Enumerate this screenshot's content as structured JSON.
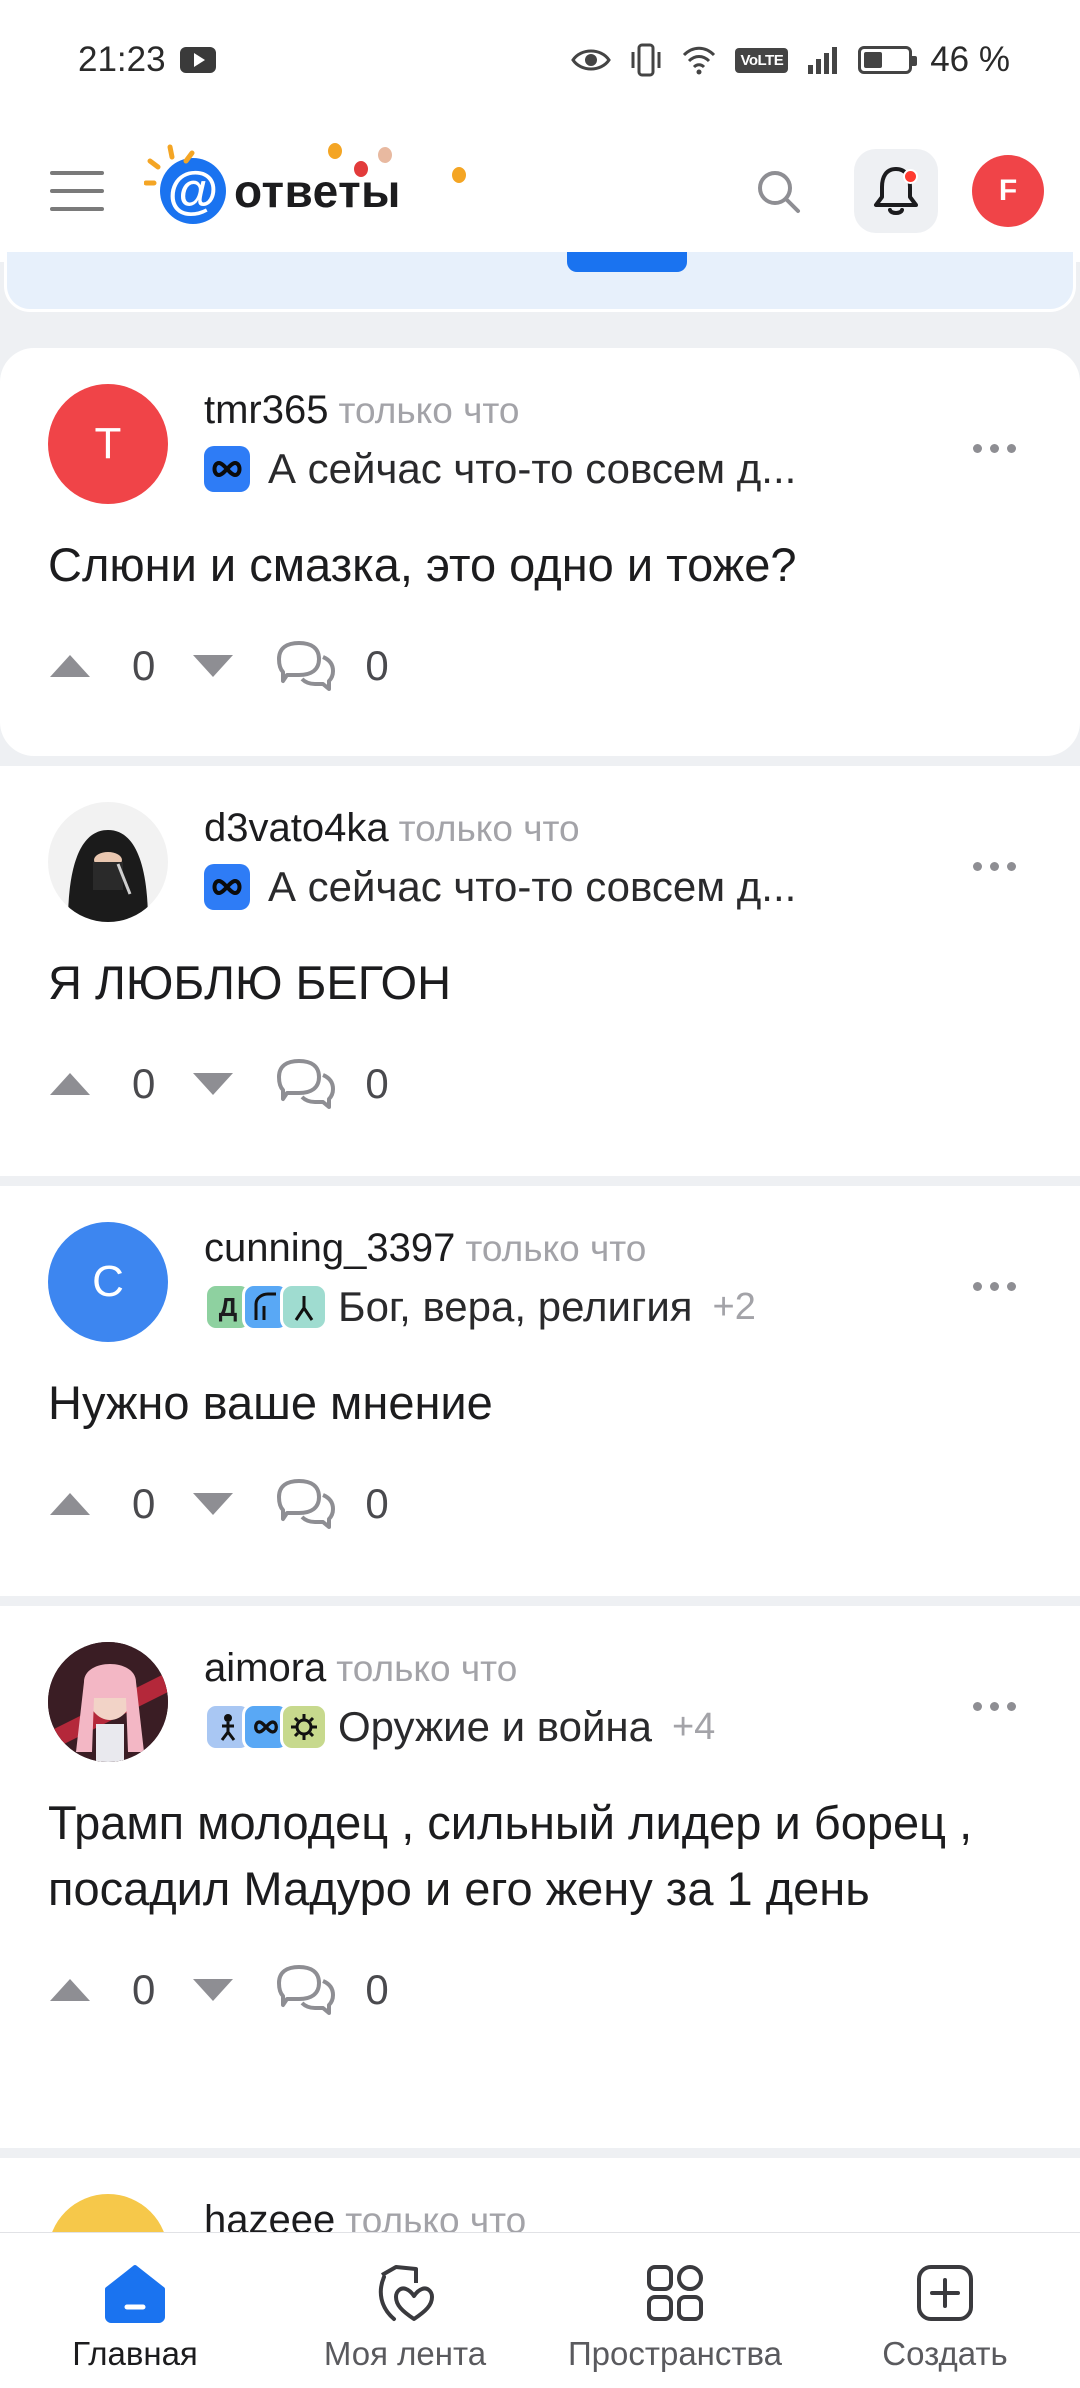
{
  "status_bar": {
    "time": "21:23",
    "volte": "VoLTE",
    "battery": "46 %"
  },
  "header": {
    "logo_text": "ответы"
  },
  "posts": [
    {
      "avatar_letter": "T",
      "avatar_color": "#f04448",
      "author": "tmr365",
      "time": "только что",
      "category": "А сейчас что-то совсем д...",
      "category_more": "",
      "title": "Слюни и смазка, это одно и тоже?",
      "votes": "0",
      "comments": "0"
    },
    {
      "avatar_letter": "",
      "avatar_color": "#ffffff",
      "author": "d3vato4ka",
      "time": "только что",
      "category": "А сейчас что-то совсем д...",
      "category_more": "",
      "title": "Я ЛЮБЛЮ БЕГОН",
      "votes": "0",
      "comments": "0"
    },
    {
      "avatar_letter": "C",
      "avatar_color": "#3d86f0",
      "author": "cunning_3397",
      "time": "только что",
      "category": "Бог, вера, религия",
      "category_more": "+2",
      "title": "Нужно ваше мнение",
      "votes": "0",
      "comments": "0"
    },
    {
      "avatar_letter": "",
      "avatar_color": "#3a1d24",
      "author": "aimora",
      "time": "только что",
      "category": "Оружие и война",
      "category_more": "+4",
      "title": "Трамп молодец , сильный лидер и борец , посадил Мадуро и его жену за 1 день",
      "votes": "0",
      "comments": "0"
    },
    {
      "avatar_letter": "",
      "avatar_color": "#f6c84a",
      "author": "hazeee",
      "time": "только что"
    }
  ],
  "category_icon_letter": "Д",
  "nav": {
    "home": "Главная",
    "feed": "Моя лента",
    "spaces": "Пространства",
    "create": "Создать"
  },
  "colors": {
    "accent": "#1a73f0",
    "text_secondary": "#a3a3a8"
  }
}
